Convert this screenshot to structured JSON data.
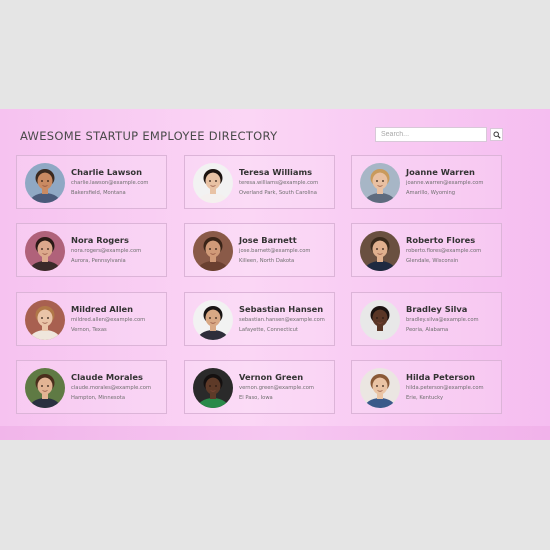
{
  "header": {
    "title": "AWESOME STARTUP EMPLOYEE DIRECTORY"
  },
  "search": {
    "placeholder": "Search...",
    "button_icon": "search-icon"
  },
  "employees": [
    {
      "name": "Charlie Lawson",
      "email": "charlie.lawson@example.com",
      "location": "Bakersfield, Montana",
      "skin": "#c98a62",
      "hair": "#3b2a20",
      "shirt": "#4a5a7a",
      "bg": "#8fa8c4"
    },
    {
      "name": "Teresa Williams",
      "email": "teresa.williams@example.com",
      "location": "Overland Park, South Carolina",
      "skin": "#e8c2a4",
      "hair": "#1c1410",
      "shirt": "#f4f0ee",
      "bg": "#f2f2f2"
    },
    {
      "name": "Joanne Warren",
      "email": "joanne.warren@example.com",
      "location": "Amarillo, Wyoming",
      "skin": "#e9c0a2",
      "hair": "#c99a5c",
      "shirt": "#5e6b7e",
      "bg": "#a7b6c6"
    },
    {
      "name": "Nora Rogers",
      "email": "nora.rogers@example.com",
      "location": "Aurora, Pennsylvania",
      "skin": "#dca88c",
      "hair": "#2a1a16",
      "shirt": "#3a2a2a",
      "bg": "#b0627a"
    },
    {
      "name": "Jose Barnett",
      "email": "jose.barnett@example.com",
      "location": "Killeen, North Dakota",
      "skin": "#d09a78",
      "hair": "#3a2418",
      "shirt": "#6a4030",
      "bg": "#8a5a48"
    },
    {
      "name": "Roberto Flores",
      "email": "roberto.flores@example.com",
      "location": "Glendale, Wisconsin",
      "skin": "#e0b08e",
      "hair": "#3a2a1c",
      "shirt": "#1f2a40",
      "bg": "#6a5040"
    },
    {
      "name": "Mildred Allen",
      "email": "mildred.allen@example.com",
      "location": "Vernon, Texas",
      "skin": "#eac4a8",
      "hair": "#b07848",
      "shirt": "#efe6dc",
      "bg": "#a86050"
    },
    {
      "name": "Sebastian Hansen",
      "email": "sebastian.hansen@example.com",
      "location": "Lafayette, Connecticut",
      "skin": "#d8a884",
      "hair": "#181414",
      "shirt": "#2e2e3a",
      "bg": "#f2f2f2"
    },
    {
      "name": "Bradley Silva",
      "email": "bradley.silva@example.com",
      "location": "Peoria, Alabama",
      "skin": "#5a3626",
      "hair": "#1a1210",
      "shirt": "#e8e8e8",
      "bg": "#e8e8e8"
    },
    {
      "name": "Claude Morales",
      "email": "claude.morales@example.com",
      "location": "Hampton, Minnesota",
      "skin": "#e2b494",
      "hair": "#4a2e1c",
      "shirt": "#2a3040",
      "bg": "#5f7a44"
    },
    {
      "name": "Vernon Green",
      "email": "vernon.green@example.com",
      "location": "El Paso, Iowa",
      "skin": "#5e3a28",
      "hair": "#141010",
      "shirt": "#2a8a4a",
      "bg": "#2a2a2a"
    },
    {
      "name": "Hilda Peterson",
      "email": "hilda.peterson@example.com",
      "location": "Erie, Kentucky",
      "skin": "#eac4a4",
      "hair": "#8a5a36",
      "shirt": "#3a5a8a",
      "bg": "#ebe6e2"
    }
  ]
}
